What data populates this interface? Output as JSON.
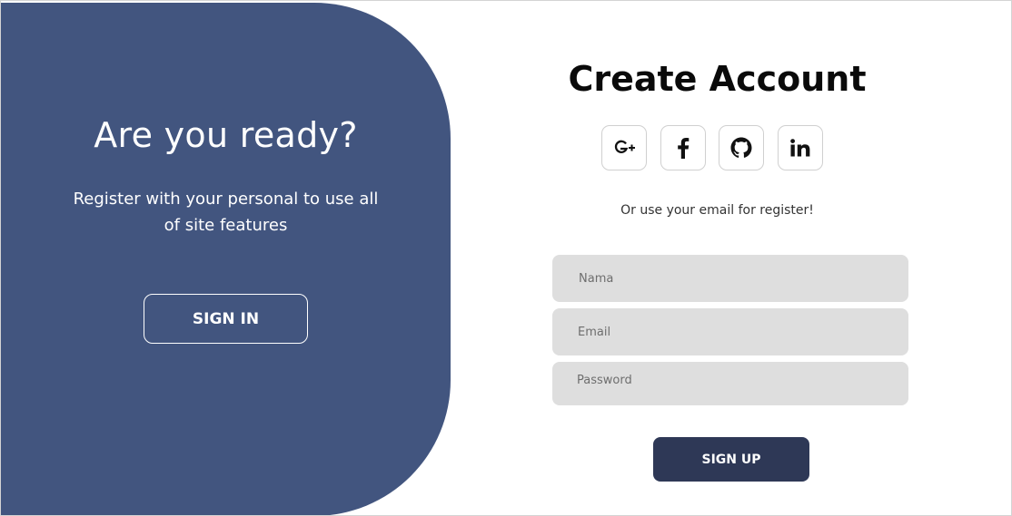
{
  "left_panel": {
    "title": "Are you ready?",
    "text": "Register with your personal to use all of site features",
    "signin_label": "SIGN IN",
    "color": "#42557f"
  },
  "form": {
    "title": "Create Account",
    "socials": [
      {
        "icon": "google-plus-icon"
      },
      {
        "icon": "facebook-icon"
      },
      {
        "icon": "github-icon"
      },
      {
        "icon": "linkedin-icon"
      }
    ],
    "subtitle": "Or use your email for register!",
    "name_placeholder": "Nama",
    "email_placeholder": "Email",
    "password_placeholder": "Password",
    "signup_label": "SIGN UP",
    "signup_color": "#2e3856"
  }
}
